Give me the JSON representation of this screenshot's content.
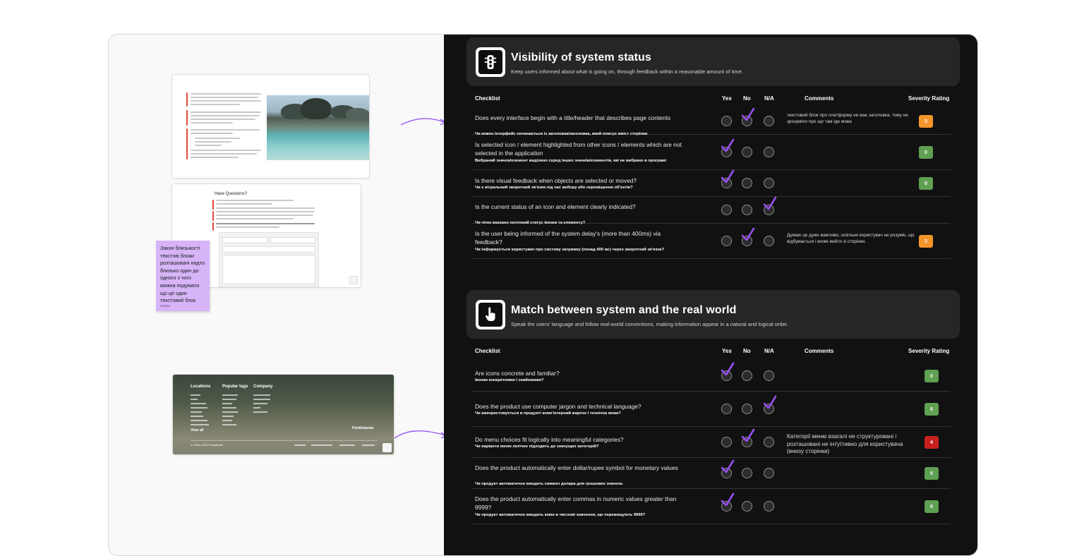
{
  "sticky": {
    "text": "Закон близькості текстові блоки розташовані надто близько один до одного з чого можна подумати що це один текстовий блок",
    "author": "Natalia"
  },
  "thumb2": {
    "title": "Have Questions?"
  },
  "thumb3": {
    "cols": [
      "Locations",
      "Popular tags",
      "Company"
    ],
    "view_all": "View all",
    "brand": "FindIslands",
    "copyright": "© 2000–2023 FindIslands"
  },
  "sections": [
    {
      "title": "Visibility of system status",
      "subtitle": "Keep users informed about what is going on, through feedback within a reasonable amount of time.",
      "icon": "traffic-light-icon",
      "headers": {
        "checklist": "Checklist",
        "yes": "Yes",
        "no": "No",
        "na": "N/A",
        "comments": "Comments",
        "severity": "Severity Rating"
      },
      "rows": [
        {
          "question": "Does every interface begin with a title/header that describes page contents",
          "translation": "Чи кожен інтерфейс починається із заголовка/заголовка, який описує вміст сторінки",
          "answer": "no",
          "comment": "текстовий блок про платформу не має заголовка, тому не зрозуміло про що там іде мова",
          "severity": "3",
          "severity_color": "#f4952b"
        },
        {
          "question": "Is selected icon / element highlighted from other icons / elements which are not selected in the application",
          "translation": "Вибраний значок/елемент виділено серед інших значків/елементів, які не вибрано в програмі",
          "answer": "yes",
          "comment": "",
          "severity": "0",
          "severity_color": "#5fa052"
        },
        {
          "question": "Is there visual feedback when objects are selected or moved?",
          "translation": "Чи є візуальний зворотний зв'язок під час вибору або переміщення об'єктів?",
          "answer": "yes",
          "comment": "",
          "severity": "0",
          "severity_color": "#5fa052"
        },
        {
          "question": "Is the current status of an icon and element clearly indicated?",
          "translation": "Чи чітко вказано поточний статус іконки та елементу?",
          "answer": "na",
          "comment": "",
          "severity": "",
          "severity_color": ""
        },
        {
          "question": "Is the user being informed of the system delay's (more than 400ms) via feedback?",
          "translation": "Чи інформується користувач про систему затримку (понад 400 мс) через зворотний зв'язок?",
          "answer": "no",
          "comment": "Думаю це дуже важливо, оскільки користувач не розуміє, що відбувається і може вийти зі сторінки.",
          "severity": "3",
          "severity_color": "#f4952b"
        }
      ]
    },
    {
      "title": "Match between system and the real world",
      "subtitle": "Speak the users' language and follow real-world conventions, making information appear in a natural and logical order.",
      "icon": "hand-pointer-icon",
      "headers": {
        "checklist": "Checklist",
        "yes": "Yes",
        "no": "No",
        "na": "N/A",
        "comments": "Comments",
        "severity": "Severity Rating"
      },
      "rows": [
        {
          "question": "Are icons concrete and familiar?",
          "translation": "Іконки конкретними і знайомими?",
          "answer": "yes",
          "comment": "",
          "severity": "0",
          "severity_color": "#5fa052"
        },
        {
          "question": "Does the product use computer jargon and technical language?",
          "translation": "Чи використовується в продукті комп'ютерний жаргон і технічна мова?",
          "answer": "na",
          "comment": "",
          "severity": "0",
          "severity_color": "#5fa052"
        },
        {
          "question": "Do menu choices fit logically into meaningful categories?",
          "translation": "Чи варіанти меню логічно підходять до значущих категорій?",
          "answer": "no",
          "comment": "Категорії меню взагалі не структуровані і розташовані не інтуїтивно для користувача (внизу сторінки)",
          "severity": "4",
          "severity_color": "#c8201f"
        },
        {
          "question": "Does the product automatically enter dollar/rupee symbol for monetary values",
          "translation": "Чи продукт автоматично вводить символ долара для грошових значень",
          "answer": "yes",
          "comment": "",
          "severity": "0",
          "severity_color": "#5fa052"
        },
        {
          "question": "Does the product automatically enter commas in numeric values greater than 9999?",
          "translation": "Чи продукт автоматично вводить коми в числові значення, що перевищують 9999?",
          "answer": "yes",
          "comment": "",
          "severity": "0",
          "severity_color": "#5fa052"
        }
      ]
    }
  ]
}
